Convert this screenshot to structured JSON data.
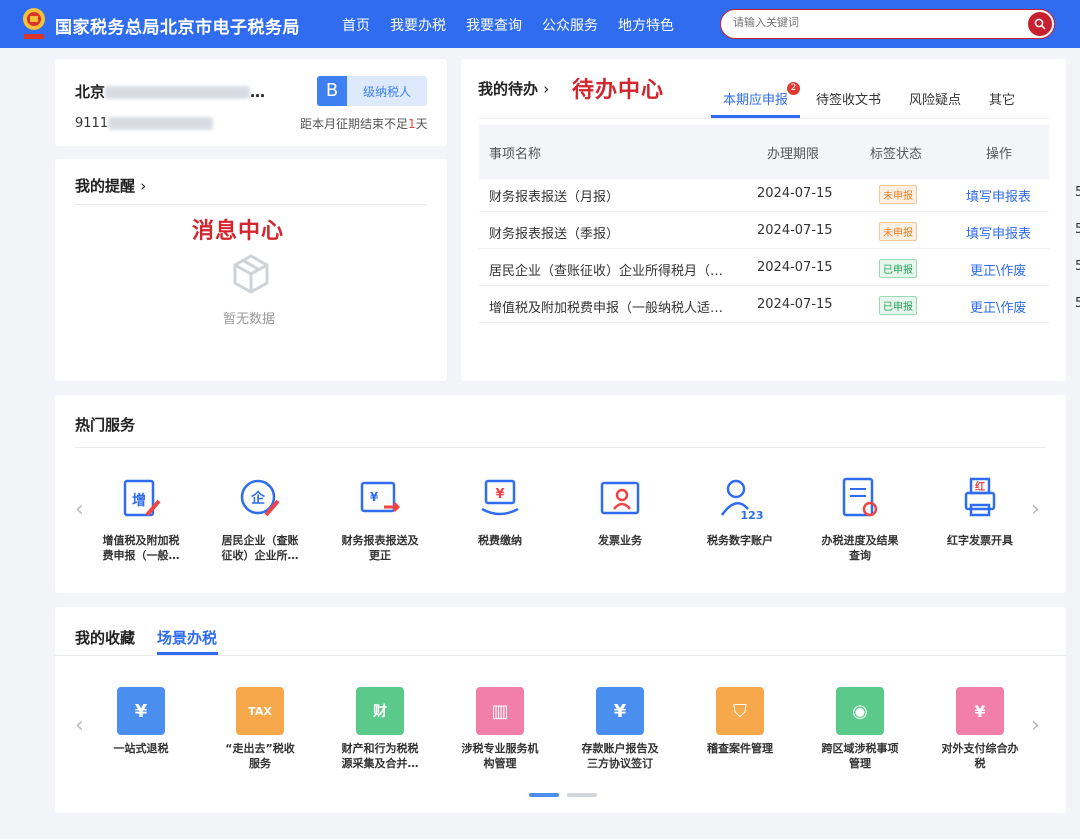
{
  "header": {
    "site_title": "国家税务总局北京市电子税务局",
    "nav": [
      "首页",
      "我要办税",
      "我要查询",
      "公众服务",
      "地方特色"
    ],
    "search_placeholder": "请输入关键词"
  },
  "taxpayer": {
    "name_prefix": "北京",
    "id_prefix": "9111",
    "level_letter": "B",
    "level_text": "级纳税人",
    "deadline_before": "距本月征期结束不足",
    "deadline_days": "1",
    "deadline_after": "天"
  },
  "reminder": {
    "title": "我的提醒",
    "annotation": "消息中心",
    "empty_text": "暂无数据"
  },
  "todo": {
    "title": "我的待办",
    "annotation": "待办中心",
    "tabs": [
      {
        "label": "本期应申报",
        "badge": "2"
      },
      {
        "label": "待签收文书"
      },
      {
        "label": "风险疑点"
      },
      {
        "label": "其它"
      }
    ],
    "columns": [
      "事项名称",
      "办理期限",
      "标签状态",
      "操作"
    ],
    "rows": [
      {
        "name": "财务报表报送（月报）",
        "deadline": "2024-07-15",
        "status": "未申报",
        "status_type": "pending",
        "op": "填写申报表",
        "edge": "5"
      },
      {
        "name": "财务报表报送（季报）",
        "deadline": "2024-07-15",
        "status": "未申报",
        "status_type": "pending",
        "op": "填写申报表",
        "edge": "5"
      },
      {
        "name": "居民企业（查账征收）企业所得税月（…",
        "deadline": "2024-07-15",
        "status": "已申报",
        "status_type": "done",
        "op": "更正\\作废",
        "edge": "5"
      },
      {
        "name": "增值税及附加税费申报（一般纳税人适…",
        "deadline": "2024-07-15",
        "status": "已申报",
        "status_type": "done",
        "op": "更正\\作废",
        "edge": "5"
      }
    ]
  },
  "hot_services": {
    "title": "热门服务",
    "items": [
      {
        "line1": "增值税及附加税",
        "line2": "费申报（一般…",
        "icon": "vat-declare-icon"
      },
      {
        "line1": "居民企业（查账",
        "line2": "征收）企业所…",
        "icon": "enterprise-tax-icon"
      },
      {
        "line1": "财务报表报送及",
        "line2": "更正",
        "icon": "financial-report-icon"
      },
      {
        "line1": "税费缴纳",
        "line2": "",
        "icon": "tax-payment-icon"
      },
      {
        "line1": "发票业务",
        "line2": "",
        "icon": "invoice-icon"
      },
      {
        "line1": "税务数字账户",
        "line2": "",
        "icon": "digital-account-icon"
      },
      {
        "line1": "办税进度及结果",
        "line2": "查询",
        "icon": "progress-query-icon"
      },
      {
        "line1": "红字发票开具",
        "line2": "",
        "icon": "red-invoice-icon"
      }
    ]
  },
  "favorites": {
    "tabs": [
      "我的收藏",
      "场景办税"
    ],
    "active": 1,
    "items": [
      {
        "line1": "一站式退税",
        "line2": "",
        "color": "#4a8ef0",
        "icon": "refund-icon"
      },
      {
        "line1": "“走出去”税收",
        "line2": "服务",
        "color": "#f6a84a",
        "icon": "go-global-icon"
      },
      {
        "line1": "财产和行为税税",
        "line2": "源采集及合并…",
        "color": "#5ac98a",
        "icon": "property-tax-icon"
      },
      {
        "line1": "涉税专业服务机",
        "line2": "构管理",
        "color": "#f27fa8",
        "icon": "agency-icon"
      },
      {
        "line1": "存款账户报告及",
        "line2": "三方协议签订",
        "color": "#4a8ef0",
        "icon": "bank-account-icon"
      },
      {
        "line1": "稽查案件管理",
        "line2": "",
        "color": "#f6a84a",
        "icon": "inspection-icon"
      },
      {
        "line1": "跨区域涉税事项",
        "line2": "管理",
        "color": "#5ac98a",
        "icon": "cross-region-icon"
      },
      {
        "line1": "对外支付综合办",
        "line2": "税",
        "color": "#f27fa8",
        "icon": "outbound-payment-icon"
      }
    ]
  }
}
